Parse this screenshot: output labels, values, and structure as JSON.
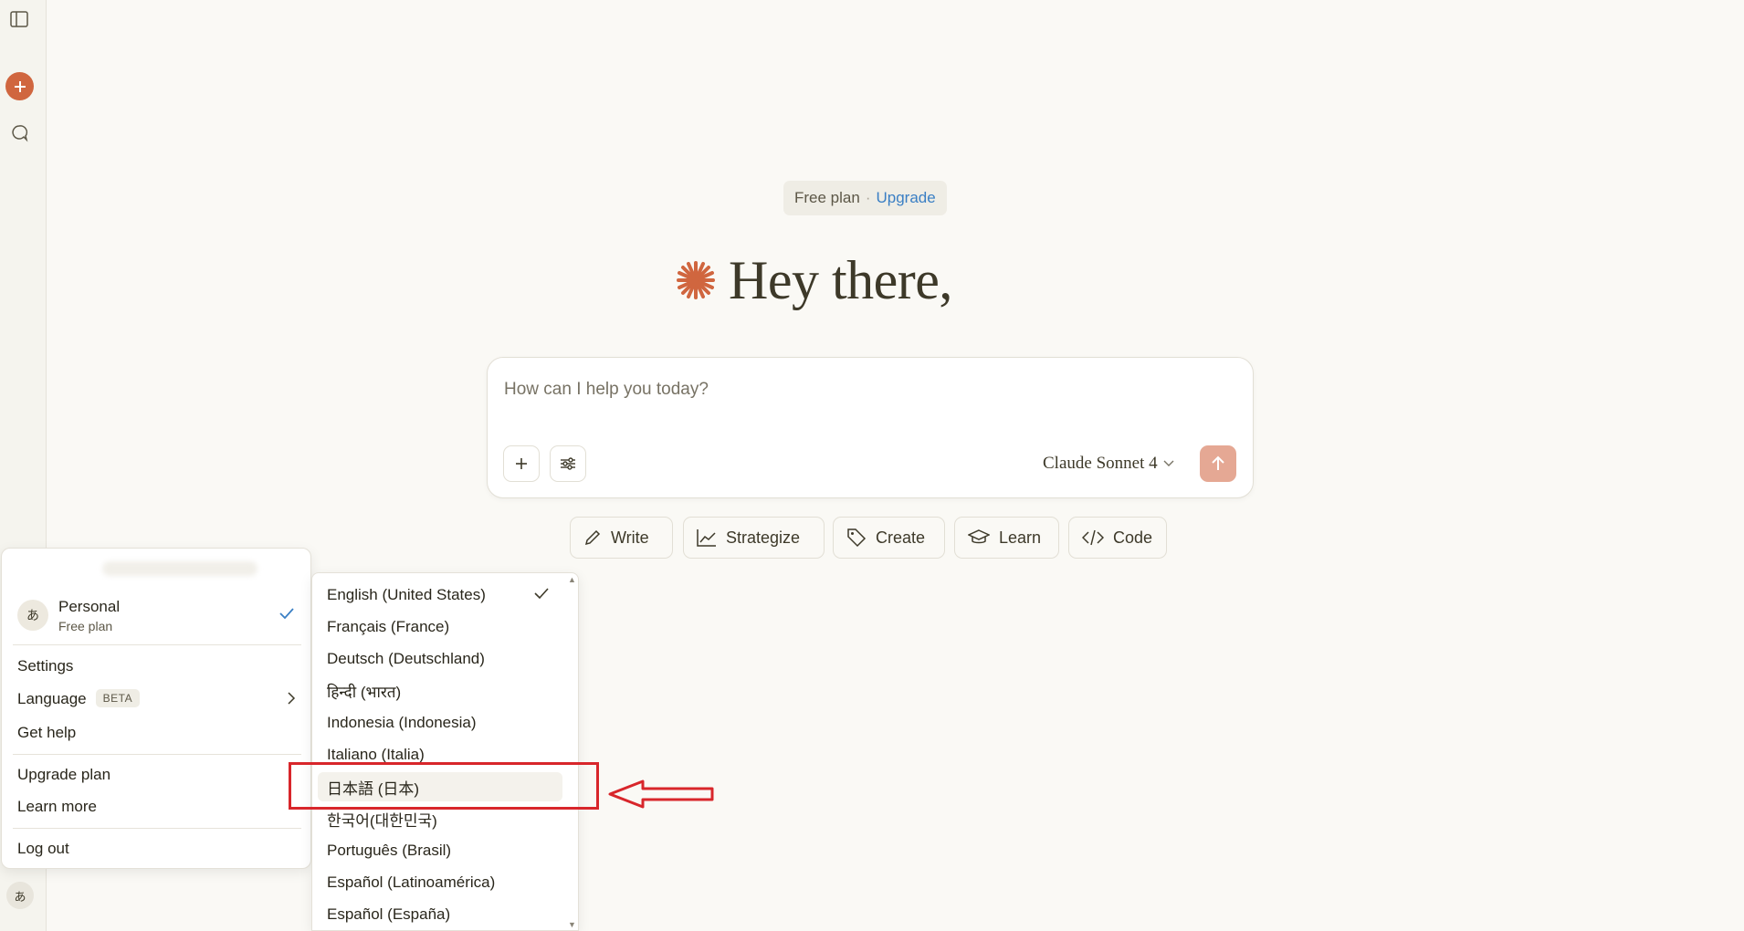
{
  "header": {
    "plan": "Free plan",
    "separator": "·",
    "upgrade": "Upgrade",
    "greeting": "Hey there,"
  },
  "composer": {
    "placeholder": "How can I help you today?",
    "model": "Claude Sonnet 4"
  },
  "quick_actions": [
    {
      "label": "Write",
      "icon": "pencil-icon"
    },
    {
      "label": "Strategize",
      "icon": "chart-line-icon"
    },
    {
      "label": "Create",
      "icon": "tag-icon"
    },
    {
      "label": "Learn",
      "icon": "graduation-cap-icon"
    },
    {
      "label": "Code",
      "icon": "code-icon"
    }
  ],
  "account_menu": {
    "avatar": "あ",
    "name": "Personal",
    "plan": "Free plan",
    "settings": "Settings",
    "language": "Language",
    "beta": "BETA",
    "help": "Get help",
    "upgrade": "Upgrade plan",
    "learn_more": "Learn more",
    "logout": "Log out"
  },
  "languages": [
    "English (United States)",
    "Français (France)",
    "Deutsch (Deutschland)",
    "हिन्दी (भारत)",
    "Indonesia (Indonesia)",
    "Italiano (Italia)",
    "日本語 (日本)",
    "한국어(대한민국)",
    "Português (Brasil)",
    "Español (Latinoamérica)",
    "Español (España)"
  ],
  "selected_language_index": 0,
  "highlighted_language_index": 6,
  "rail": {
    "avatar": "あ"
  },
  "colors": {
    "accent": "#d0663f",
    "link": "#3a7fc4",
    "annotation": "#d8262b"
  }
}
